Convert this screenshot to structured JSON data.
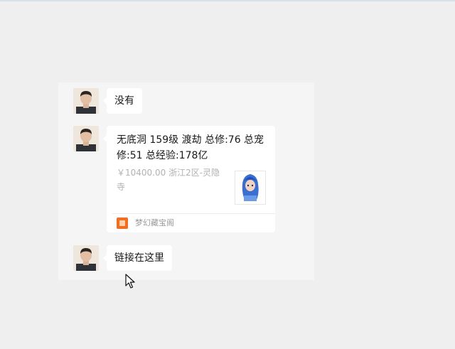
{
  "chat": {
    "messages": [
      {
        "type": "text",
        "text": "没有"
      },
      {
        "type": "link-card",
        "title": "无底洞 159级 渡劫 总修:76 总宠修:51 总经验:178亿",
        "subtitle": "￥10400.00 浙江2区-灵隐寺",
        "source": "梦幻藏宝阁",
        "thumbnail_icon": "character-thumbnail"
      },
      {
        "type": "text",
        "text": "链接在这里"
      }
    ]
  },
  "avatar_icon": "person-avatar",
  "colors": {
    "background": "#efefef",
    "chat_panel": "#f5f5f5",
    "bubble": "#ffffff",
    "card_logo": "#f26c22"
  }
}
